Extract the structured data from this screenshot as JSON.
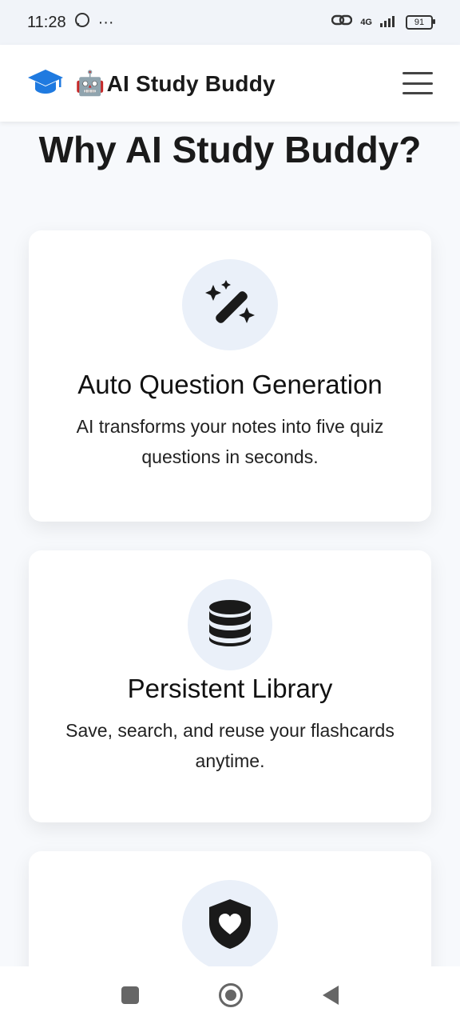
{
  "status_bar": {
    "time": "11:28",
    "ellipsis": "···",
    "network": "4G",
    "battery": "91"
  },
  "header": {
    "logo_icon": "graduation-cap-icon",
    "robot_emoji": "🤖",
    "title": "AI Study Buddy",
    "menu_icon": "hamburger-icon"
  },
  "section": {
    "title": "Why AI Study Buddy?"
  },
  "features": [
    {
      "icon": "magic-wand-icon",
      "title": "Auto Question Generation",
      "description": "AI transforms your notes into five quiz questions in seconds."
    },
    {
      "icon": "database-icon",
      "title": "Persistent Library",
      "description": "Save, search, and reuse your flashcards anytime."
    },
    {
      "icon": "shield-heart-icon"
    }
  ],
  "colors": {
    "accent_blue": "#1f7ae0",
    "icon_bg": "#eaf0f9",
    "text_dark": "#1a1a1a"
  }
}
